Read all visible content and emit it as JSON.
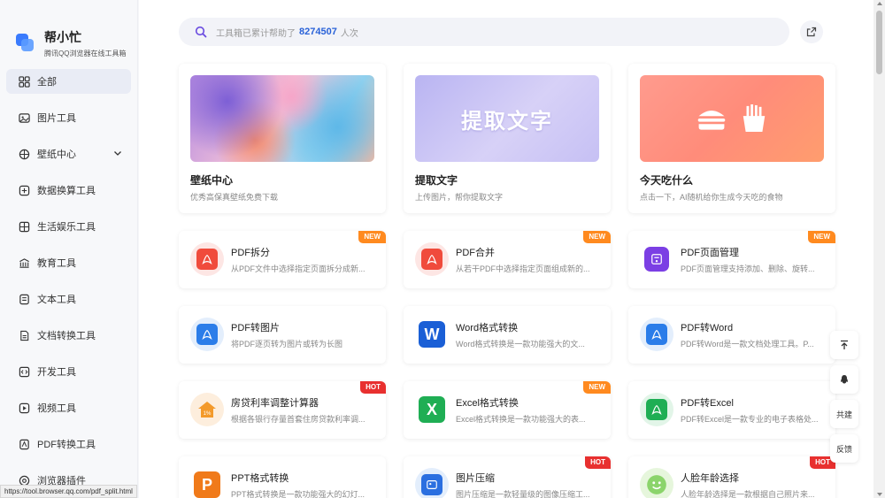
{
  "brand": {
    "name": "帮小忙",
    "subtitle": "腾讯QQ浏览器在线工具箱"
  },
  "sidebar": {
    "items": [
      {
        "label": "全部",
        "icon": "apps-icon"
      },
      {
        "label": "图片工具",
        "icon": "image-icon"
      },
      {
        "label": "壁纸中心",
        "icon": "wallpaper-icon"
      },
      {
        "label": "数据换算工具",
        "icon": "calculator-icon"
      },
      {
        "label": "生活娱乐工具",
        "icon": "grid-icon"
      },
      {
        "label": "教育工具",
        "icon": "education-icon"
      },
      {
        "label": "文本工具",
        "icon": "text-icon"
      },
      {
        "label": "文档转换工具",
        "icon": "document-icon"
      },
      {
        "label": "开发工具",
        "icon": "code-icon"
      },
      {
        "label": "视频工具",
        "icon": "video-icon"
      },
      {
        "label": "PDF转换工具",
        "icon": "pdf-icon"
      },
      {
        "label": "浏览器插件",
        "icon": "plugin-icon"
      }
    ]
  },
  "search": {
    "prefix": "工具箱已累计帮助了",
    "count": "8274507",
    "suffix": "人次"
  },
  "features": [
    {
      "title": "壁纸中心",
      "desc": "优秀高保真壁纸免费下载"
    },
    {
      "title": "提取文字",
      "desc": "上传图片，帮你提取文字",
      "image_text": "提取文字"
    },
    {
      "title": "今天吃什么",
      "desc": "点击一下，AI随机给你生成今天吃的食物"
    }
  ],
  "tools": [
    {
      "title": "PDF拆分",
      "desc": "从PDF文件中选择指定页面拆分成新...",
      "badge": "NEW",
      "icon": "pdf-split-icon",
      "color": "#f04b3c"
    },
    {
      "title": "PDF合并",
      "desc": "从若干PDF中选择指定页面组成新的...",
      "badge": "NEW",
      "icon": "pdf-merge-icon",
      "color": "#f04b3c"
    },
    {
      "title": "PDF页面管理",
      "desc": "PDF页面管理支持添加、删除、旋转...",
      "badge": "NEW",
      "icon": "pdf-manage-icon",
      "color": "#7b3fe4"
    },
    {
      "title": "PDF转图片",
      "desc": "将PDF逐页转为图片或转为长图",
      "badge": "",
      "icon": "pdf-to-image-icon",
      "color": "#2b7de9"
    },
    {
      "title": "Word格式转换",
      "desc": "Word格式转换是一款功能强大的文...",
      "badge": "",
      "icon": "word-icon",
      "color": "#1a5fd6",
      "glyph": "W"
    },
    {
      "title": "PDF转Word",
      "desc": "PDF转Word是一款文档处理工具。P...",
      "badge": "",
      "icon": "pdf-to-word-icon",
      "color": "#2b7de9"
    },
    {
      "title": "房贷利率调整计算器",
      "desc": "根据各银行存量首套住房贷款利率调...",
      "badge": "HOT",
      "icon": "house-loan-icon",
      "color": "#f39a2b"
    },
    {
      "title": "Excel格式转换",
      "desc": "Excel格式转换是一款功能强大的表...",
      "badge": "NEW",
      "icon": "excel-icon",
      "color": "#1fae54",
      "glyph": "X"
    },
    {
      "title": "PDF转Excel",
      "desc": "PDF转Excel是一款专业的电子表格处...",
      "badge": "",
      "icon": "pdf-to-excel-icon",
      "color": "#1fae54"
    },
    {
      "title": "PPT格式转换",
      "desc": "PPT格式转换是一款功能强大的幻灯...",
      "badge": "",
      "icon": "ppt-icon",
      "color": "#f07a1a",
      "glyph": "P"
    },
    {
      "title": "图片压缩",
      "desc": "图片压缩是一款轻量级的图像压缩工...",
      "badge": "HOT",
      "icon": "image-compress-icon",
      "color": "#2b6fe0"
    },
    {
      "title": "人脸年龄选择",
      "desc": "人脸年龄选择是一款根据自己照片来...",
      "badge": "HOT",
      "icon": "face-age-icon",
      "color": "#8bd46b"
    }
  ],
  "float": {
    "share": "共建",
    "feedback": "反馈"
  },
  "status_url": "https://tool.browser.qq.com/pdf_split.html"
}
